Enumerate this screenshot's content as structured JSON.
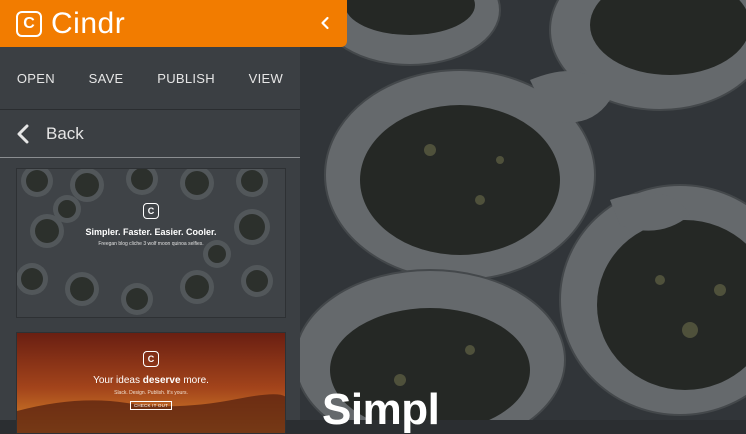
{
  "app": {
    "name": "Cindr",
    "logo_letter": "C"
  },
  "header": {
    "collapse_icon": "chevron-left-icon",
    "brand_color": "#f27c00"
  },
  "menu": {
    "items": [
      {
        "label": "OPEN"
      },
      {
        "label": "SAVE"
      },
      {
        "label": "PUBLISH"
      },
      {
        "label": "VIEW"
      }
    ]
  },
  "back": {
    "label": "Back",
    "icon": "chevron-left-icon"
  },
  "templates": [
    {
      "logo_letter": "C",
      "heading": "Simpler. Faster. Easier. Cooler.",
      "subtext": "Freegan blog cliche 3 wolf moon quinoa selfies."
    },
    {
      "logo_letter": "C",
      "heading_pre": "Your ideas ",
      "heading_bold": "deserve",
      "heading_post": " more.",
      "subtext": "Slack. Design. Publish. It's yours.",
      "button_label": "CHECK IT OUT"
    }
  ],
  "canvas": {
    "title": "Simpl"
  }
}
